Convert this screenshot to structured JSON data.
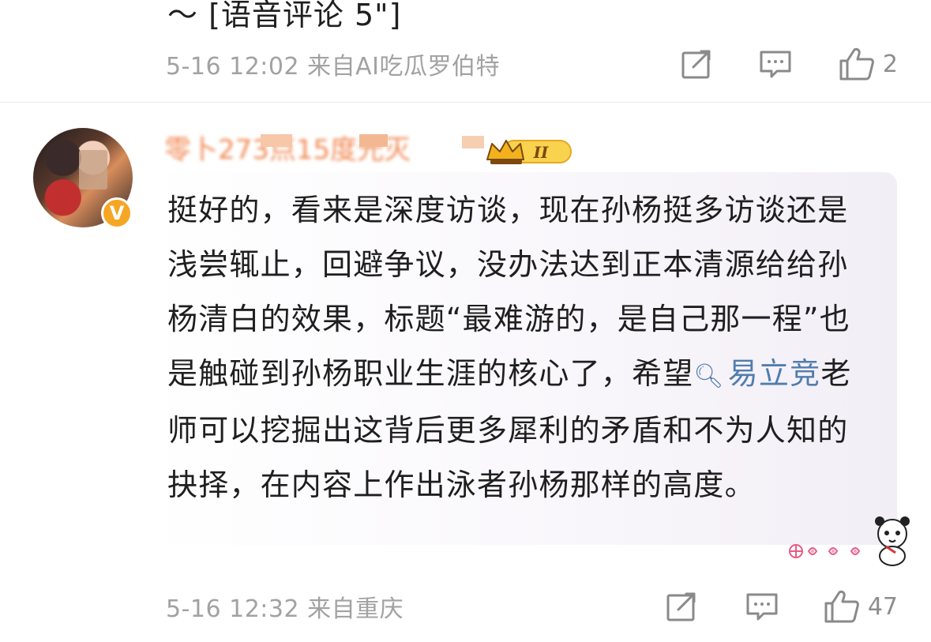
{
  "previous_comment": {
    "text_tail": "～ [语音评论 5\"]",
    "meta": "5-16 12:02  来自AI吃瓜罗伯特",
    "like_count": "2",
    "icons": [
      "share-icon",
      "comment-icon",
      "like-icon"
    ]
  },
  "comment": {
    "username": "零卜273点15度光灭",
    "badge_label": "II",
    "body_before": "挺好的，看来是深度访谈，现在孙杨挺多访谈还是浅尝辄止，回避争议，没办法达到正本清源给给孙杨清白的效果，标题“最难游的，是自己那一程”也是触碰到孙杨职业生涯的核心了，希望",
    "mention": "易立竞",
    "body_after": "老师可以挖掘出这背后更多犀利的矛盾和不为人知的抉择，在内容上作出泳者孙杨那样的高度。",
    "meta": "5-16 12:32  来自重庆",
    "like_count": "47",
    "verified_mark": "V"
  },
  "colors": {
    "text": "#1f1f1f",
    "meta": "#a2a2a2",
    "mention": "#507daf",
    "username": "#f07b3f",
    "verified": "#f5a623",
    "bubble": "#f2eef6"
  }
}
